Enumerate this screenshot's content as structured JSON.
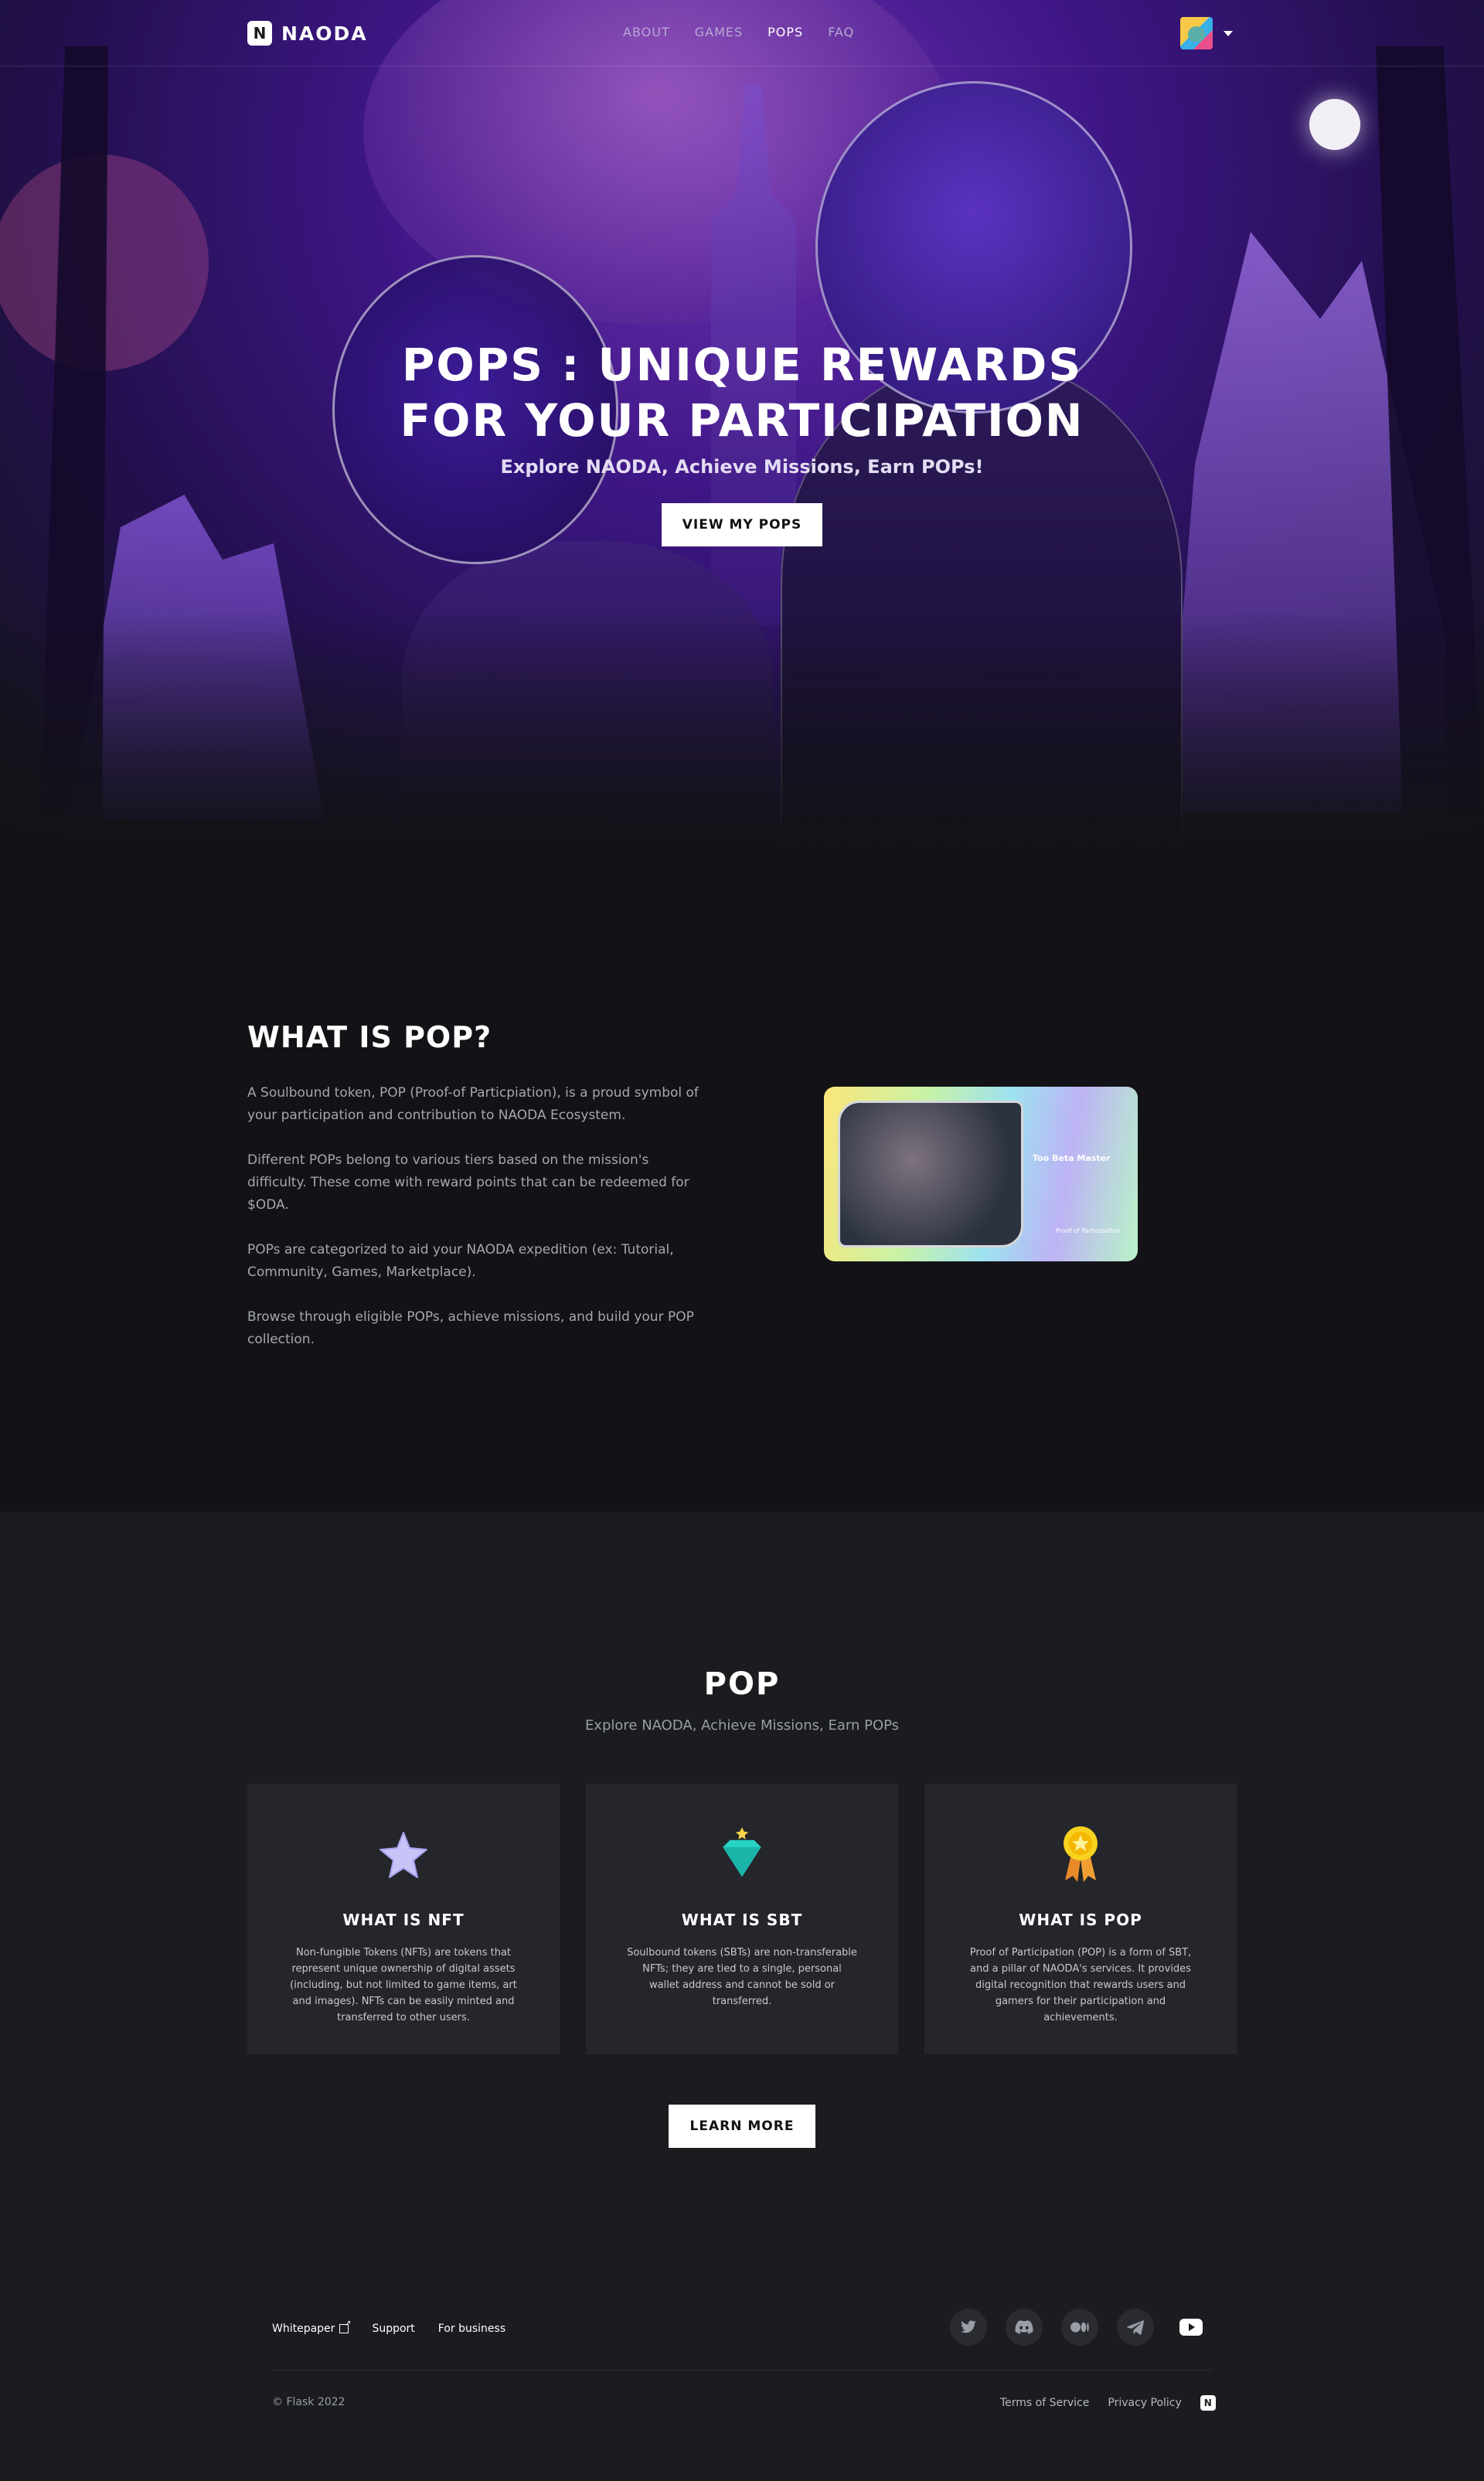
{
  "nav": {
    "logo_mark": "N",
    "logo_text": "NAODA",
    "links": [
      "ABOUT",
      "GAMES",
      "POPS",
      "FAQ"
    ],
    "active": "POPS"
  },
  "hero": {
    "title_line1": "POPS : UNIQUE REWARDS",
    "title_line2": "FOR YOUR PARTICIPATION",
    "subtitle": "Explore NAODA, Achieve Missions, Earn POPs!",
    "button": "VIEW MY POPS"
  },
  "what_is_pop": {
    "title": "WHAT IS POP?",
    "paragraphs": [
      "A Soulbound token, POP (Proof-of Particpiation), is a proud symbol of your participation and contribution to NAODA Ecosystem.",
      "Different POPs belong to various tiers based on the mission's difficulty. These come with reward points that can be redeemed for $ODA.",
      "POPs are categorized to aid your NAODA expedition (ex: Tutorial, Community, Games, Marketplace).",
      "Browse through eligible POPs, achieve missions, and build your POP collection."
    ],
    "card_title": "Too Beta Master",
    "card_footer": "Proof of Participation"
  },
  "pop_section": {
    "title": "POP",
    "subtitle": "Explore NAODA, Achieve Missions, Earn POPs",
    "cards": [
      {
        "icon": "star-icon",
        "title": "WHAT IS NFT",
        "text": "Non-fungible Tokens (NFTs) are tokens that represent unique ownership of digital assets (including, but not limited to game items, art and images). NFTs can be easily minted and transferred to other users."
      },
      {
        "icon": "gem-icon",
        "title": "WHAT IS SBT",
        "text": "Soulbound tokens (SBTs) are non-transferable NFTs; they are tied to a single, personal wallet address and cannot be sold or transferred."
      },
      {
        "icon": "medal-icon",
        "title": "WHAT IS POP",
        "text": "Proof of Participation (POP) is a form of SBT, and a pillar of NAODA's services. It provides digital recognition that rewards users and gamers for their participation and achievements."
      }
    ],
    "button": "LEARN MORE"
  },
  "footer": {
    "links": [
      "Whitepaper",
      "Support",
      "For business"
    ],
    "socials": [
      "twitter-icon",
      "discord-icon",
      "medium-icon",
      "telegram-icon",
      "youtube-icon"
    ],
    "copyright": "© Flask 2022",
    "legal": [
      "Terms of Service",
      "Privacy Policy"
    ]
  },
  "colors": {
    "page_bg": "#1b1c20",
    "dark_bg": "#131317",
    "card_bg": "#25262b",
    "hero_purple": "#3d1684"
  }
}
